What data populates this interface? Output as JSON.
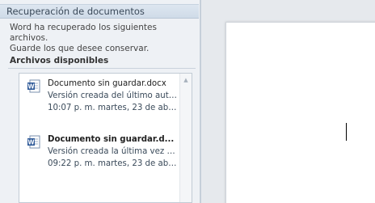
{
  "pane": {
    "title": "Recuperación de documentos",
    "description_line1": "Word ha recuperado los siguientes archivos.",
    "description_line2": "Guarde los que desee conservar.",
    "section_label": "Archivos disponibles"
  },
  "files": [
    {
      "name": "Documento sin guardar.docx",
      "description": "Versión creada del último auto...",
      "timestamp": "10:07 p. m. martes, 23 de abr...",
      "icon": "word-document-icon"
    },
    {
      "name": "Documento sin guardar.d...",
      "description": "Versión creada la última vez q...",
      "timestamp": "09:22 p. m. martes, 23 de abr...",
      "icon": "word-document-icon"
    }
  ],
  "colors": {
    "word_blue": "#2b5797",
    "pane_background": "#eef1f5",
    "title_bar": "#d6e0eb"
  }
}
